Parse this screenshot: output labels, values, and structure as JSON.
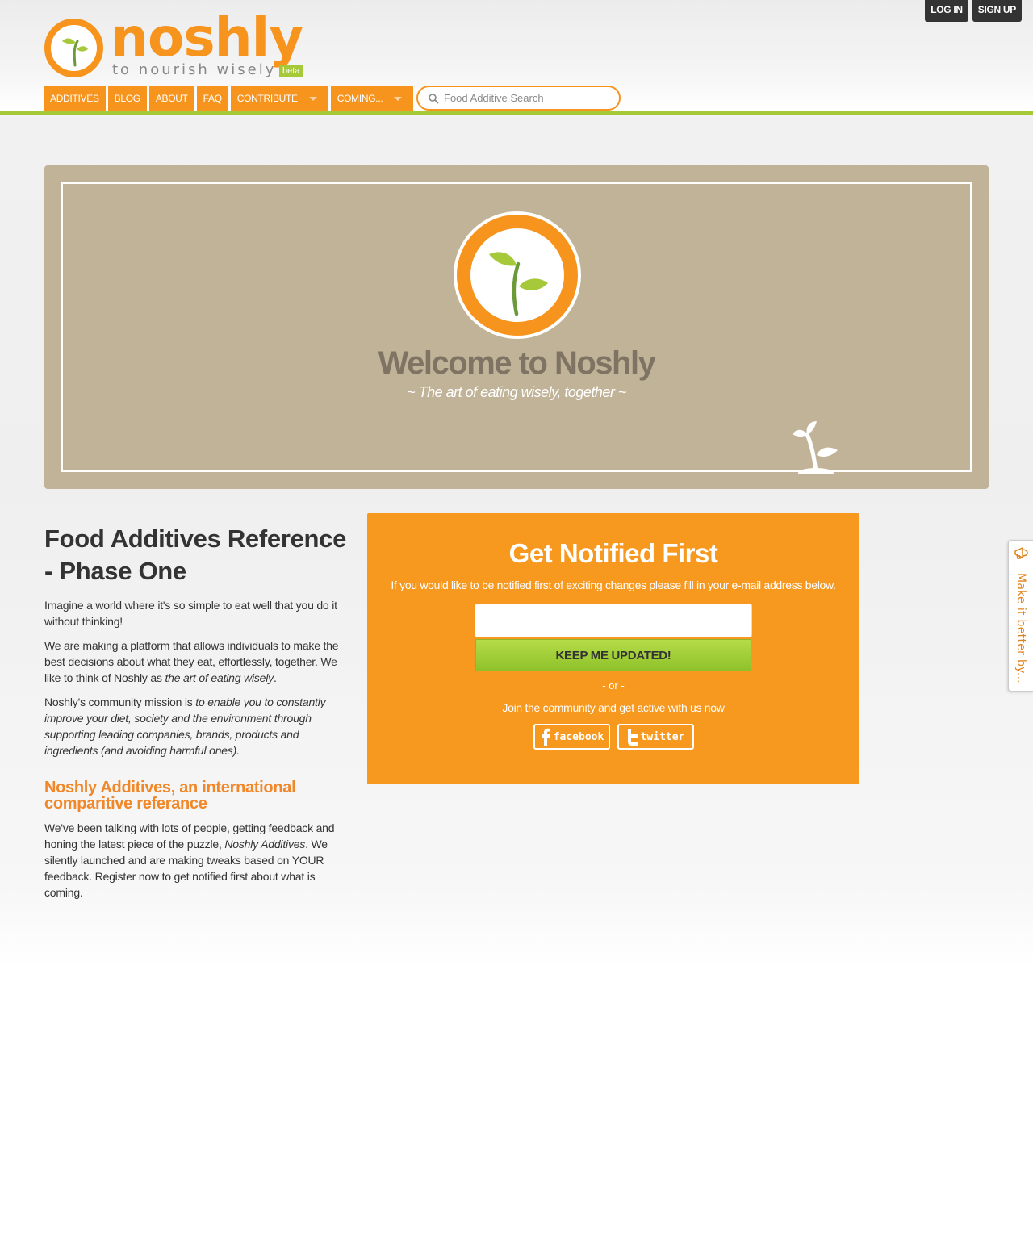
{
  "header": {
    "auth": {
      "login": "LOG IN",
      "signup": "SIGN UP"
    },
    "logo": {
      "word": "noshly",
      "tagline": "to nourish wisely",
      "badge": "beta"
    },
    "nav": [
      {
        "label": "ADDITIVES",
        "dropdown": false
      },
      {
        "label": "BLOG",
        "dropdown": false
      },
      {
        "label": "ABOUT",
        "dropdown": false
      },
      {
        "label": "FAQ",
        "dropdown": false
      },
      {
        "label": "CONTRIBUTE",
        "dropdown": true
      },
      {
        "label": "COMING...",
        "dropdown": true
      }
    ],
    "search": {
      "placeholder": "Food Additive Search",
      "value": ""
    }
  },
  "hero": {
    "title": "Welcome to Noshly",
    "subtitle": "~ The art of eating wisely, together ~"
  },
  "intro": {
    "heading": "Food Additives Reference - Phase One",
    "p1": "Imagine a world where it's so simple to eat well that you do it without thinking!",
    "p2_text": "We are making a platform that allows individuals to make the best decisions about what they eat, effortlessly, together. We like to think of Noshly as ",
    "p2_em": "the art of eating wisely",
    "p2_end": ".",
    "p3_text": "Noshly's community mission is ",
    "p3_em": "to enable you to constantly improve your diet, society and the environment through supporting leading companies, brands, products and ingredients (and avoiding harmful ones).",
    "subheading": "Noshly Additives, an international comparitive referance",
    "p4_text": "We've been talking with lots of people, getting feedback and honing the latest piece of the puzzle, ",
    "p4_em": "Noshly Additives",
    "p4_end": ". We silently launched and are making tweaks based on YOUR feedback. Register now to get notified first about what is coming."
  },
  "notify": {
    "title": "Get Notified First",
    "description": "If you would like to be notified first of exciting changes please fill in your e-mail address below.",
    "email_value": "",
    "button": "KEEP ME UPDATED!",
    "or": "- or -",
    "join": "Join the community and get active with us now",
    "facebook": "facebook",
    "twitter": "twitter"
  },
  "feedback": {
    "label": "Make it better by..."
  },
  "colors": {
    "brand_orange": "#f7941e",
    "brand_green": "#a6c93a",
    "hero_bg": "#c1b398"
  }
}
